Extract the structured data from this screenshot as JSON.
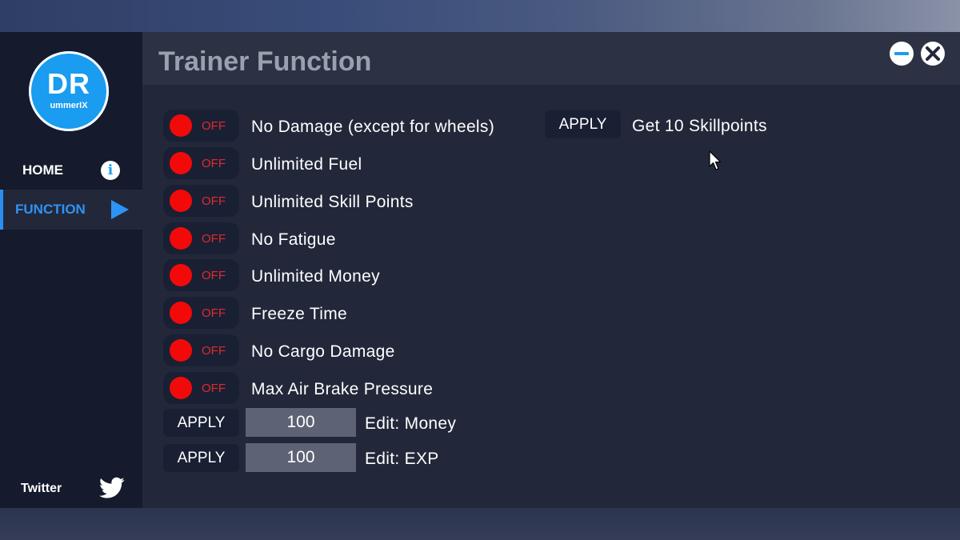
{
  "sidebar": {
    "logo": {
      "big": "DR",
      "small": "ummerIX"
    },
    "nav": [
      {
        "label": "HOME",
        "icon": "info-icon"
      },
      {
        "label": "FUNCTION",
        "icon": "play-icon"
      }
    ],
    "footer": {
      "label": "Twitter",
      "icon": "twitter-icon"
    }
  },
  "header": {
    "title": "Trainer Function"
  },
  "toggles": [
    {
      "state": "OFF",
      "label": "No Damage (except for wheels)"
    },
    {
      "state": "OFF",
      "label": "Unlimited Fuel"
    },
    {
      "state": "OFF",
      "label": "Unlimited Skill Points"
    },
    {
      "state": "OFF",
      "label": "No Fatigue"
    },
    {
      "state": "OFF",
      "label": "Unlimited Money"
    },
    {
      "state": "OFF",
      "label": "Freeze Time"
    },
    {
      "state": "OFF",
      "label": "No Cargo Damage"
    },
    {
      "state": "OFF",
      "label": "Max Air Brake Pressure"
    }
  ],
  "edits": [
    {
      "button": "APPLY",
      "value": "100",
      "label": "Edit: Money"
    },
    {
      "button": "APPLY",
      "value": "100",
      "label": "Edit: EXP"
    }
  ],
  "skill_action": {
    "button": "APPLY",
    "label": "Get 10 Skillpoints"
  },
  "colors": {
    "accent": "#2f93f5",
    "toggle_off_knob": "#f20a0a",
    "logo": "#1a9cf0"
  }
}
